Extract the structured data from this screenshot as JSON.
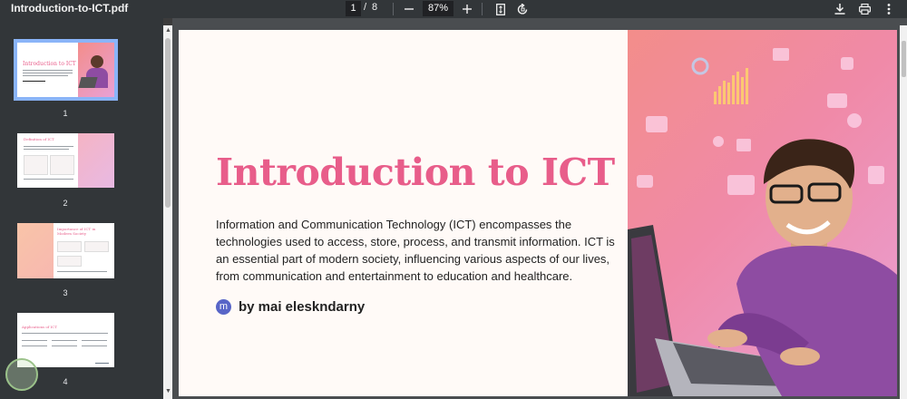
{
  "toolbar": {
    "doc_title": "Introduction-to-ICT.pdf",
    "current_page": "1",
    "page_sep": "/",
    "total_pages": "8",
    "zoom": "87%",
    "zoom_out_icon": "minus-icon",
    "zoom_in_icon": "plus-icon",
    "fit_icon": "fit-page-icon",
    "rotate_icon": "rotate-icon",
    "download_icon": "download-icon",
    "print_icon": "print-icon",
    "more_icon": "more-vert-icon"
  },
  "sidebar": {
    "thumbnails": [
      {
        "num": "1",
        "title": "Introduction to ICT"
      },
      {
        "num": "2",
        "title": "Definition of ICT"
      },
      {
        "num": "3",
        "title": "Importance of ICT in Modern Society"
      },
      {
        "num": "4",
        "title": "Applications of ICT"
      }
    ]
  },
  "slide": {
    "title": "Introduction to ICT",
    "body_lines": [
      "Information and Communication Technology (ICT) encompasses the",
      "technologies used to access, store, process, and transmit information. ICT is",
      "an essential part of modern society, influencing various aspects of our lives,",
      "from communication and entertainment to education and healthcare."
    ],
    "author_initial": "m",
    "author": "by mai eleskndarny"
  },
  "colors": {
    "accent": "#e85d8a",
    "toolbar_bg": "#323639",
    "active_thumb": "#8ab4f8",
    "avatar": "#5865c7"
  }
}
